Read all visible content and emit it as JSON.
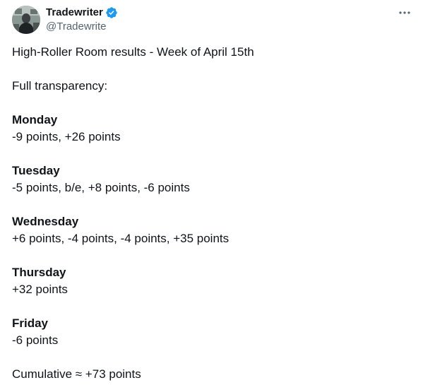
{
  "author": {
    "display_name": "Tradewriter",
    "handle": "@Tradewrite",
    "verified_icon": "verified-badge-icon",
    "badge_color": "#1d9bf0"
  },
  "post": {
    "intro": "High-Roller Room results - Week of April 15th",
    "transparency": "Full transparency:",
    "days": [
      {
        "day": "Monday",
        "results": "-9 points, +26 points"
      },
      {
        "day": "Tuesday",
        "results": "-5 points, b/e, +8 points, -6 points"
      },
      {
        "day": "Wednesday",
        "results": "+6 points, -4 points, -4 points, +35 points"
      },
      {
        "day": "Thursday",
        "results": "+32 points"
      },
      {
        "day": "Friday",
        "results": "-6 points"
      }
    ],
    "cumulative": "Cumulative ≈ +73 points"
  },
  "more_icon": "more-options-icon"
}
